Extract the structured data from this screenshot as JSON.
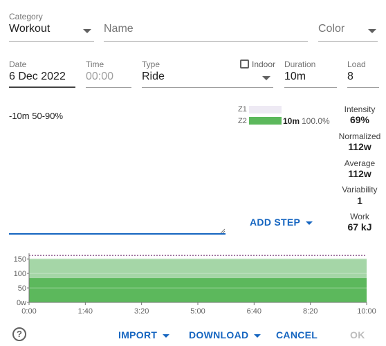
{
  "category": {
    "label": "Category",
    "value": "Workout"
  },
  "name": {
    "placeholder": "Name"
  },
  "color": {
    "placeholder": "Color"
  },
  "date": {
    "label": "Date",
    "value": "6 Dec 2022"
  },
  "time": {
    "label": "Time",
    "placeholder": "00:00"
  },
  "type": {
    "label": "Type",
    "value": "Ride"
  },
  "indoor": {
    "label": "Indoor",
    "checked": false
  },
  "duration": {
    "label": "Duration",
    "value": "10m"
  },
  "load": {
    "label": "Load",
    "value": "8"
  },
  "editor": {
    "text": "-10m 50-90%"
  },
  "zones": [
    {
      "name": "Z1",
      "fraction": 0,
      "duration": "",
      "percent": ""
    },
    {
      "name": "Z2",
      "fraction": 1.0,
      "duration": "10m",
      "percent": "100.0%"
    }
  ],
  "zone_colors": {
    "z1_track": "#eeeaf4",
    "z2_fill": "#5cb85c"
  },
  "stats": [
    {
      "label": "Intensity",
      "value": "69%"
    },
    {
      "label": "Normalized",
      "value": "112w"
    },
    {
      "label": "Average",
      "value": "112w"
    },
    {
      "label": "Variability",
      "value": "1"
    },
    {
      "label": "Work",
      "value": "67 kJ"
    }
  ],
  "add_step": {
    "label": "ADD STEP"
  },
  "chart_data": {
    "type": "area",
    "x_ticks": [
      "0:00",
      "1:40",
      "3:20",
      "5:00",
      "6:40",
      "8:20",
      "10:00"
    ],
    "y_ticks": [
      "0w",
      "50",
      "100",
      "150"
    ],
    "ylim": [
      0,
      160
    ],
    "xlim": [
      0,
      600
    ],
    "bands": [
      {
        "from": 0,
        "to": 84,
        "color": "#5cb85c"
      },
      {
        "from": 84,
        "to": 151,
        "color": "#a5d6a7"
      }
    ],
    "ftp_line": 162,
    "ftp_line_color": "#8e5a8e"
  },
  "footer": {
    "help_icon": "?",
    "import_label": "IMPORT",
    "download_label": "DOWNLOAD",
    "cancel_label": "CANCEL",
    "ok_label": "OK"
  },
  "accent": "#1565c0"
}
